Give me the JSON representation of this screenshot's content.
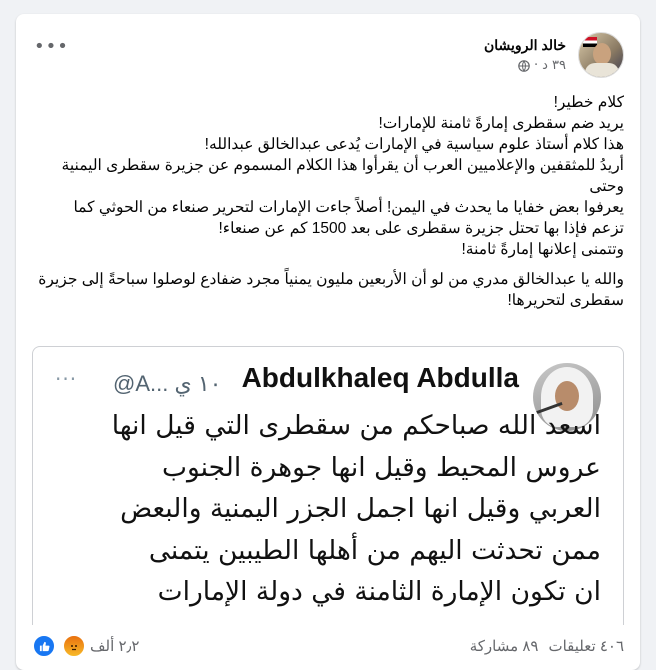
{
  "post": {
    "author": "خالد الرويشان",
    "time": "٣٩ د",
    "separator": "·",
    "more_icon": "more-horizontal-icon",
    "privacy_icon": "globe-icon",
    "lines": [
      "كلام خطير!",
      "يريد ضم سقطرى إمارةً ثامنة للإمارات!",
      "هذا كلام أستاذ علوم سياسية في الإمارات يُدعى عبدالخالق عبدالله!",
      "أريدُ للمثقفين والإعلاميين العرب أن يقرأوا هذا الكلام المسموم عن جزيرة سقطرى اليمنية وحتى",
      "يعرفوا بعض خفايا ما يحدث في اليمن! أصلاً جاءت الإمارات لتحرير صنعاء من الحوثي كما",
      "تزعم فإذا بها تحتل جزيرة سقطرى على بعد 1500 كم عن صنعاء!",
      "وتتمنى إعلانها إمارةً ثامنة!"
    ],
    "paragraph2": [
      "والله يا عبدالخالق مدري من لو أن الأربعين مليون يمنياً مجرد ضفادع لوصلوا سباحةً إلى جزيرة",
      "سقطرى لتحريرها!"
    ]
  },
  "tweet": {
    "name": "Abdulkhaleq Abdulla",
    "handle": "@A... ١٠ ي",
    "more_icon": "more-horizontal-icon",
    "lines": [
      "اسعد الله صباحكم من سقطرى التي قيل انها",
      "عروس المحيط وقيل انها جوهرة الجنوب",
      "العربي وقيل انها اجمل الجزر اليمنية والبعض",
      "ممن تحدثت اليهم من أهلها الطيبين يتمنى",
      "ان تكون الإمارة الثامنة في دولة الإمارات"
    ]
  },
  "footer": {
    "reaction_count": "٢٫٢ ألف",
    "comments": "٤٠٦ تعليقات",
    "shares": "٨٩ مشاركة",
    "reaction_icons": [
      "like-icon",
      "angry-icon"
    ],
    "colors": {
      "like": "#1877f2",
      "angry": "#e9710f"
    }
  }
}
